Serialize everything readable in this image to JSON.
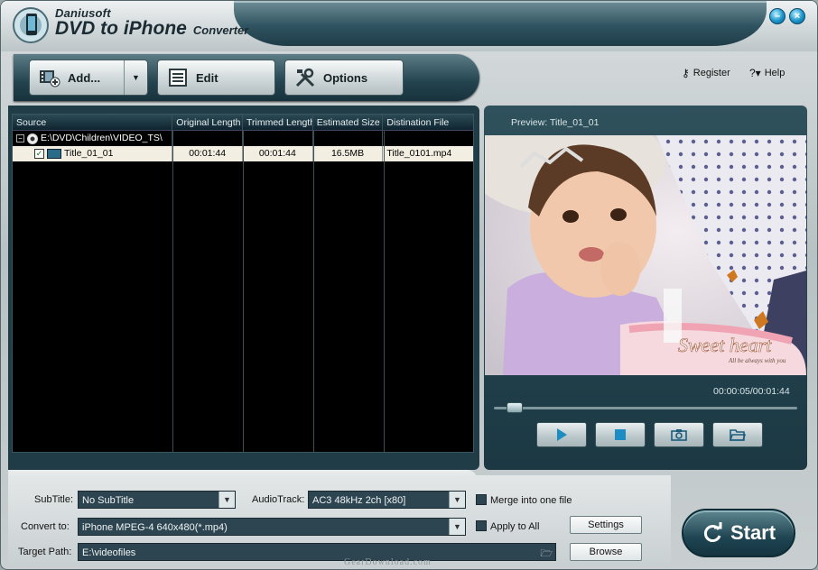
{
  "app": {
    "brand": "Daniusoft",
    "product": "DVD to iPhone",
    "suffix": "Converter"
  },
  "window_controls": {
    "minimize": "–",
    "close": "×"
  },
  "toolbar": {
    "add_label": "Add...",
    "edit_label": "Edit",
    "options_label": "Options",
    "register_label": "Register",
    "help_label": "Help"
  },
  "file_list": {
    "columns": [
      "Source",
      "Original Length",
      "Trimmed Length",
      "Estimated Size",
      "Distination File"
    ],
    "folder": {
      "path": "E:\\DVD\\Children\\VIDEO_TS\\"
    },
    "rows": [
      {
        "source": "Title_01_01",
        "original_length": "00:01:44",
        "trimmed_length": "00:01:44",
        "estimated_size": "16.5MB",
        "destination": "Title_0101.mp4",
        "checked": true
      }
    ]
  },
  "preview": {
    "title": "Preview: Title_01_01",
    "overlay_text": "Sweet heart",
    "overlay_subtext": "All be always with you",
    "timecode": "00:00:05/00:01:44",
    "progress": 0.05
  },
  "settings": {
    "subtitle_label": "SubTitle:",
    "subtitle_value": "No SubTitle",
    "audiotrack_label": "AudioTrack:",
    "audiotrack_value": "AC3 48kHz 2ch [x80]",
    "merge_label": "Merge into one file",
    "convert_label": "Convert to:",
    "convert_value": "iPhone MPEG-4 640x480(*.mp4)",
    "apply_all_label": "Apply to All",
    "settings_button": "Settings",
    "target_label": "Target Path:",
    "target_value": "E:\\videofiles",
    "browse_button": "Browse"
  },
  "start_label": "Start",
  "watermark": "GearDownload.com"
}
